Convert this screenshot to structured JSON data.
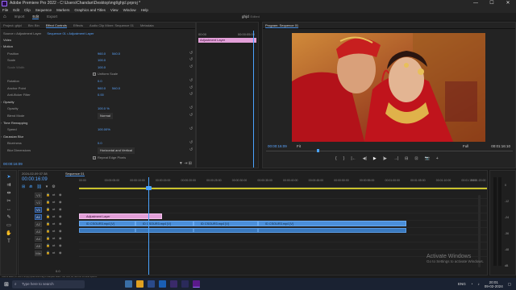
{
  "window": {
    "title": "Adobe Premiere Pro 2022 - C:\\Users\\Chandan\\Desktop\\mgt\\ghjcl.prproj *",
    "controls": [
      "—",
      "☐",
      "✕"
    ]
  },
  "menu": [
    "File",
    "Edit",
    "Clip",
    "Sequence",
    "Markers",
    "Graphics and Titles",
    "View",
    "Window",
    "Help"
  ],
  "workspaces": {
    "tabs": [
      "Import",
      "Edit",
      "Export"
    ],
    "active": "Edit",
    "center": "ghjcl",
    "center_suffix": "Edited"
  },
  "source_panel": {
    "tabs": [
      "Project: ghjcl",
      "Bin: Bin",
      "Effect Controls",
      "Effects",
      "Audio Clip Mixer: Sequence 01",
      "Metadata"
    ],
    "active": "Effect Controls",
    "source_label": "Source • Adjustment Layer",
    "sequence_label": "Sequence 01 • Adjustment Layer",
    "section_video": "Video",
    "rows": [
      {
        "name": "Motion",
        "indent": 3,
        "type": "group"
      },
      {
        "name": "Position",
        "indent": 8,
        "v1": "960.0",
        "v2": "540.0"
      },
      {
        "name": "Scale",
        "indent": 8,
        "v1": "100.0"
      },
      {
        "name": "Scale Width",
        "indent": 8,
        "v1": "100.0",
        "dim": true
      },
      {
        "name": "Uniform Scale",
        "indent": 120,
        "type": "check"
      },
      {
        "name": "Rotation",
        "indent": 8,
        "v1": "0.0"
      },
      {
        "name": "Anchor Point",
        "indent": 8,
        "v1": "960.0",
        "v2": "540.0"
      },
      {
        "name": "Anti-flicker Filter",
        "indent": 8,
        "v1": "0.00"
      },
      {
        "name": "Opacity",
        "indent": 3,
        "type": "group"
      },
      {
        "name": "Opacity",
        "indent": 8,
        "v1": "100.0 %"
      },
      {
        "name": "Blend Mode",
        "indent": 8,
        "v1": "Normal",
        "type": "select"
      },
      {
        "name": "Time Remapping",
        "indent": 3,
        "type": "group"
      },
      {
        "name": "Speed",
        "indent": 8,
        "v1": "100.00%"
      },
      {
        "name": "Gaussian Blur",
        "indent": 3,
        "type": "group"
      },
      {
        "name": "Blurriness",
        "indent": 8,
        "v1": "0.0"
      },
      {
        "name": "Blur Dimensions",
        "indent": 8,
        "v1": "Horizontal and Vertical",
        "type": "select"
      },
      {
        "name": "Repeat Edge Pixels",
        "indent": 120,
        "type": "check"
      }
    ],
    "mini_timeline": {
      "start": "00:00",
      "end": "00:00:05:00",
      "clip": "Adjustment Layer"
    },
    "timecode": "00:00:16:09"
  },
  "program": {
    "title": "Program: Sequence 01",
    "timecode": "00:00:16:09",
    "fit": "Fit",
    "quality": "Full",
    "duration": "00:01:16:10",
    "transport": [
      "{",
      "}",
      "|←",
      "◀|",
      "▶",
      "|▶",
      "→|",
      "⊟",
      "⊡",
      "📷",
      "+"
    ]
  },
  "timeline": {
    "tab": "Sequence 01",
    "timecode": "00:00:16:09",
    "date": "2024-02-09 07:38",
    "ruler": [
      "00:00",
      "00:00:05:00",
      "00:00:10:00",
      "00:00:15:00",
      "00:00:20:00",
      "00:00:25:00",
      "00:00:30:00",
      "00:00:35:00",
      "00:00:40:00",
      "00:00:45:00",
      "00:00:50:00",
      "00:00:55:00",
      "00:01:00:00",
      "00:01:05:00",
      "00:01:10:00",
      "00:01:15:00",
      "00:01:20:00"
    ],
    "tracks": [
      {
        "label": "V3"
      },
      {
        "label": "V2"
      },
      {
        "label": "V1",
        "sel": true
      },
      {
        "label": "A1",
        "sel": true
      },
      {
        "label": "A2"
      },
      {
        "label": "A3"
      },
      {
        "label": "A4"
      },
      {
        "label": "A5"
      },
      {
        "label": "Mix"
      }
    ],
    "adjustment_clip": "Adjustment Layer",
    "video_clips": [
      "ID CSOUR3.mp4 [V]",
      "ID CSOUR3.mp4 [V]",
      "ID CSOUR3.mp4 [V]",
      "ID CSOUR3.mp4 [V]"
    ],
    "mix_value": "0.0"
  },
  "meters": {
    "labels": [
      "0",
      "-12",
      "-24",
      "-36",
      "-48",
      "dB"
    ]
  },
  "activate": {
    "title": "Activate Windows",
    "sub": "Go to Settings to activate Windows."
  },
  "status_hint": "Click to select, or click in empty space and drag to marquee select. Use Shift, Alt, and Ctrl for other options.",
  "taskbar": {
    "search": "Type here to search",
    "lang": "ENG",
    "time": "20:01",
    "date": "09-02-2024"
  },
  "colors": {
    "accent": "#4a90e2",
    "clip_video": "#4b8fd9",
    "clip_adj": "#e29fd8",
    "playhead": "#4aa3ff"
  }
}
